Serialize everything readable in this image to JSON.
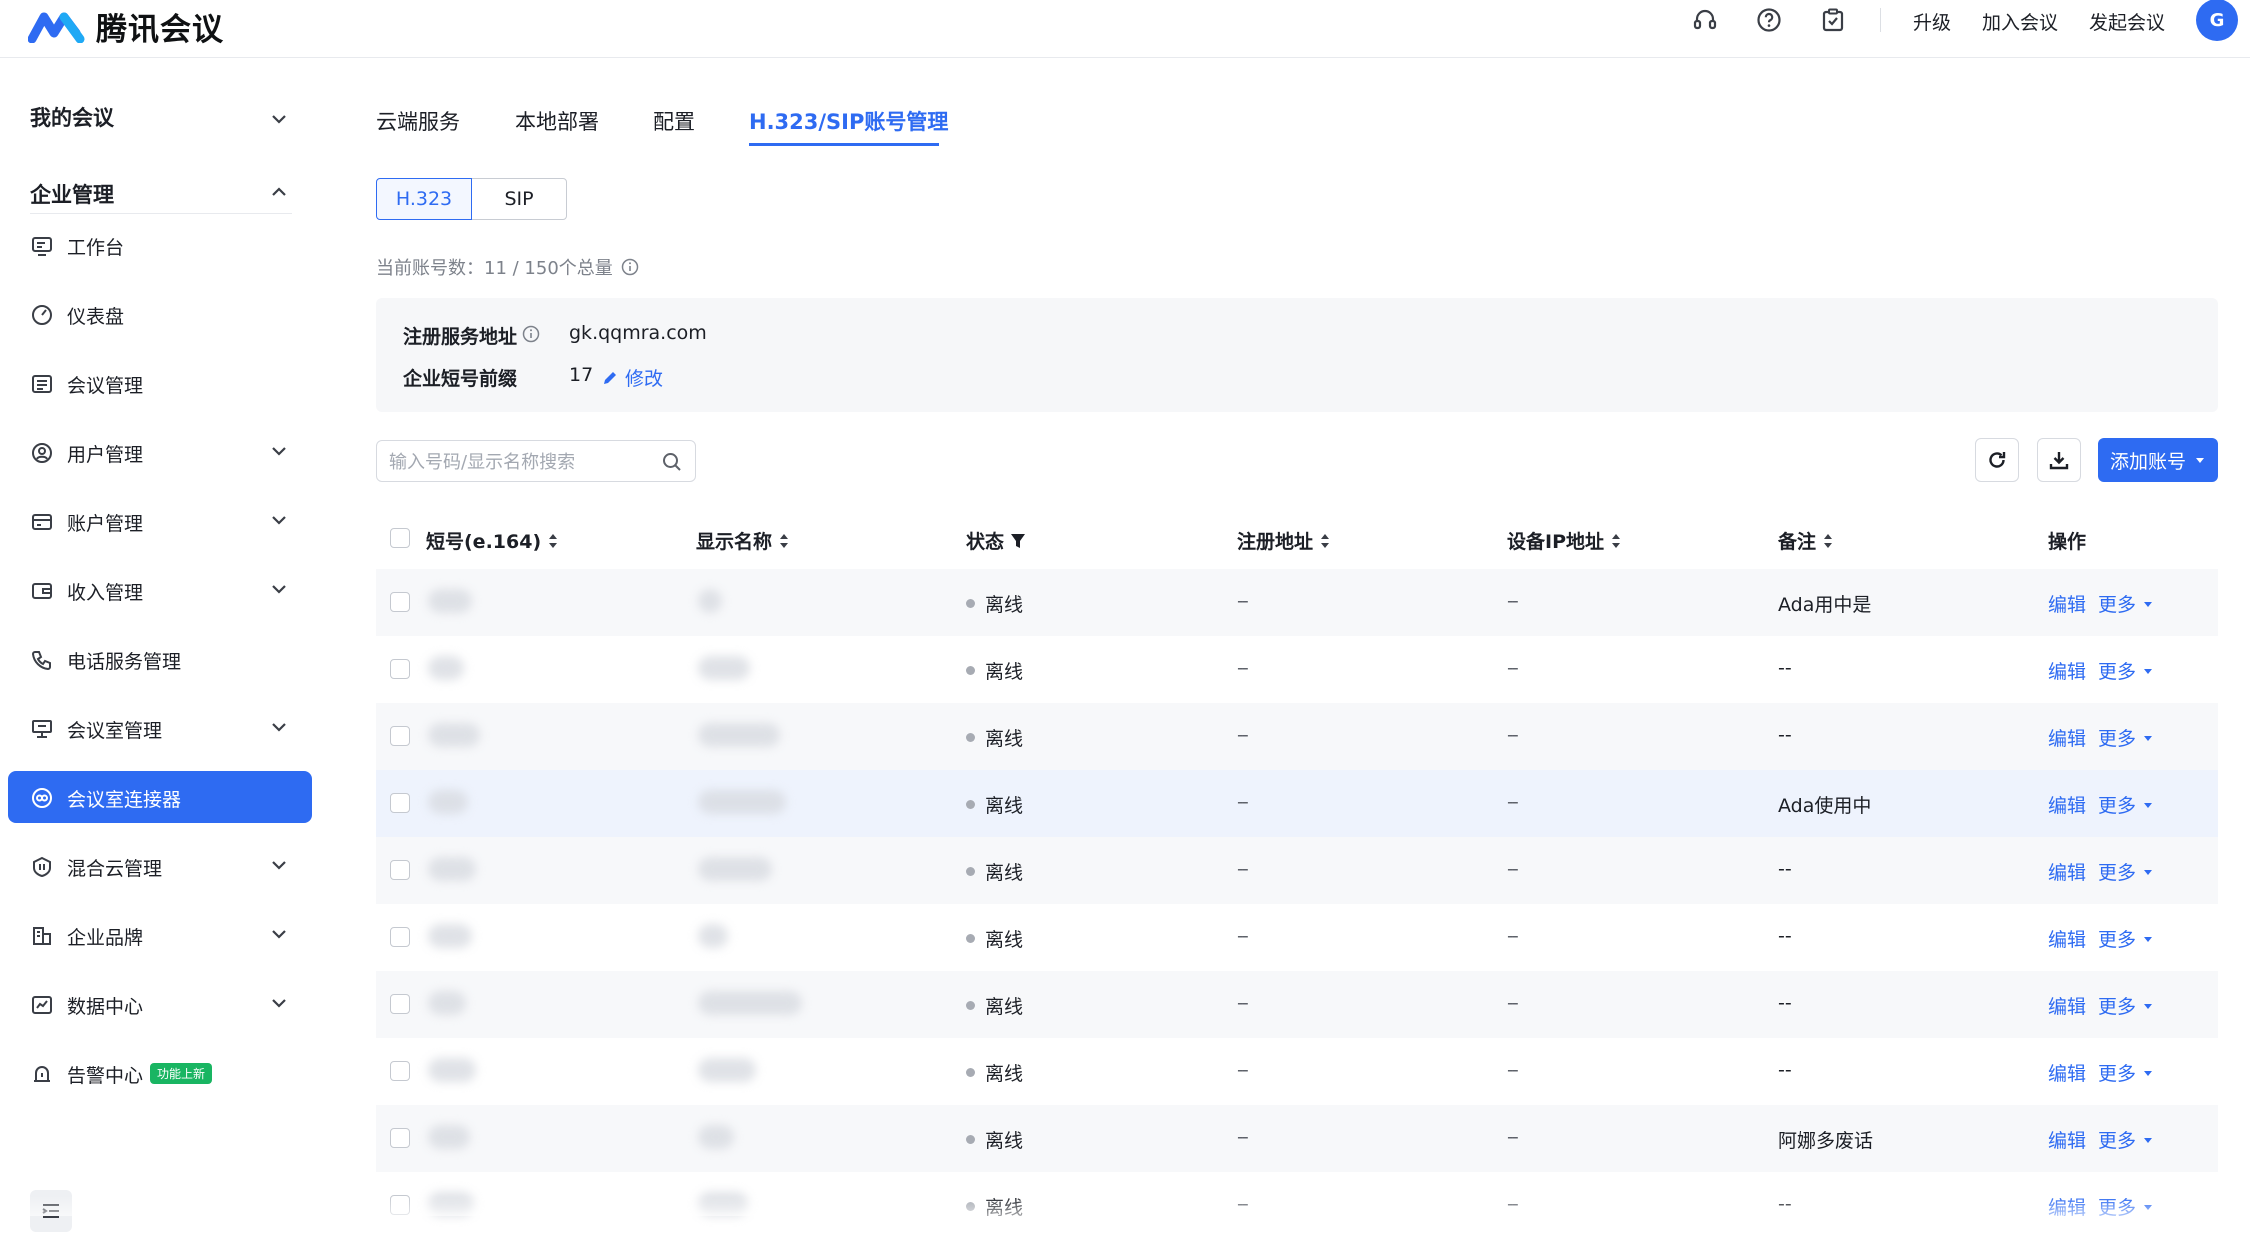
{
  "header": {
    "app_name": "腾讯会议",
    "links": [
      "升级",
      "加入会议",
      "发起会议"
    ],
    "avatar_initial": "G",
    "icons": [
      "headset-icon",
      "help-icon",
      "clipboard-check-icon"
    ]
  },
  "sidebar": {
    "my_meetings": "我的会议",
    "enterprise_mgmt": "企业管理",
    "items": [
      {
        "label": "工作台",
        "icon": "workbench-icon",
        "expandable": false
      },
      {
        "label": "仪表盘",
        "icon": "gauge-icon",
        "expandable": false
      },
      {
        "label": "会议管理",
        "icon": "list-icon",
        "expandable": false
      },
      {
        "label": "用户管理",
        "icon": "user-icon",
        "expandable": true
      },
      {
        "label": "账户管理",
        "icon": "account-icon",
        "expandable": true
      },
      {
        "label": "收入管理",
        "icon": "wallet-icon",
        "expandable": true
      },
      {
        "label": "电话服务管理",
        "icon": "phone-icon",
        "expandable": false
      },
      {
        "label": "会议室管理",
        "icon": "room-icon",
        "expandable": true
      },
      {
        "label": "会议室连接器",
        "icon": "connector-icon",
        "expandable": false,
        "active": true
      },
      {
        "label": "混合云管理",
        "icon": "hybrid-cloud-icon",
        "expandable": true
      },
      {
        "label": "企业品牌",
        "icon": "brand-icon",
        "expandable": true
      },
      {
        "label": "数据中心",
        "icon": "chart-icon",
        "expandable": true
      },
      {
        "label": "告警中心",
        "icon": "alarm-icon",
        "expandable": false,
        "badge": "功能上新"
      }
    ]
  },
  "tabs": [
    "云端服务",
    "本地部署",
    "配置",
    "H.323/SIP账号管理"
  ],
  "active_tab": "H.323/SIP账号管理",
  "protocol_switch": [
    "H.323",
    "SIP"
  ],
  "count_line": "当前账号数：11 / 150个总量",
  "info": {
    "server_label": "注册服务地址",
    "server_value": "gk.qqmra.com",
    "prefix_label": "企业短号前缀",
    "prefix_value": "17",
    "edit_label": "修改"
  },
  "search": {
    "placeholder": "输入号码/显示名称搜索"
  },
  "add_button": "添加账号",
  "table": {
    "columns": [
      "短号(e.164)",
      "显示名称",
      "状态",
      "注册地址",
      "设备IP地址",
      "备注",
      "操作"
    ],
    "rows": [
      {
        "status": "离线",
        "reg": "--",
        "ip": "--",
        "note": "Ada用中是",
        "edit": "编辑",
        "more": "更多"
      },
      {
        "status": "离线",
        "reg": "--",
        "ip": "--",
        "note": "--",
        "edit": "编辑",
        "more": "更多"
      },
      {
        "status": "离线",
        "reg": "--",
        "ip": "--",
        "note": "--",
        "edit": "编辑",
        "more": "更多"
      },
      {
        "status": "离线",
        "reg": "--",
        "ip": "--",
        "note": "Ada使用中",
        "edit": "编辑",
        "more": "更多"
      },
      {
        "status": "离线",
        "reg": "--",
        "ip": "--",
        "note": "--",
        "edit": "编辑",
        "more": "更多"
      },
      {
        "status": "离线",
        "reg": "--",
        "ip": "--",
        "note": "--",
        "edit": "编辑",
        "more": "更多"
      },
      {
        "status": "离线",
        "reg": "--",
        "ip": "--",
        "note": "--",
        "edit": "编辑",
        "more": "更多"
      },
      {
        "status": "离线",
        "reg": "--",
        "ip": "--",
        "note": "--",
        "edit": "编辑",
        "more": "更多"
      },
      {
        "status": "离线",
        "reg": "--",
        "ip": "--",
        "note": "阿娜多废话",
        "edit": "编辑",
        "more": "更多"
      },
      {
        "status": "离线",
        "reg": "--",
        "ip": "--",
        "note": "--",
        "edit": "编辑",
        "more": "更多"
      }
    ]
  },
  "colors": {
    "accent": "#2e6bf2",
    "badge": "#19b562",
    "status_offline": "#a7abb3"
  }
}
